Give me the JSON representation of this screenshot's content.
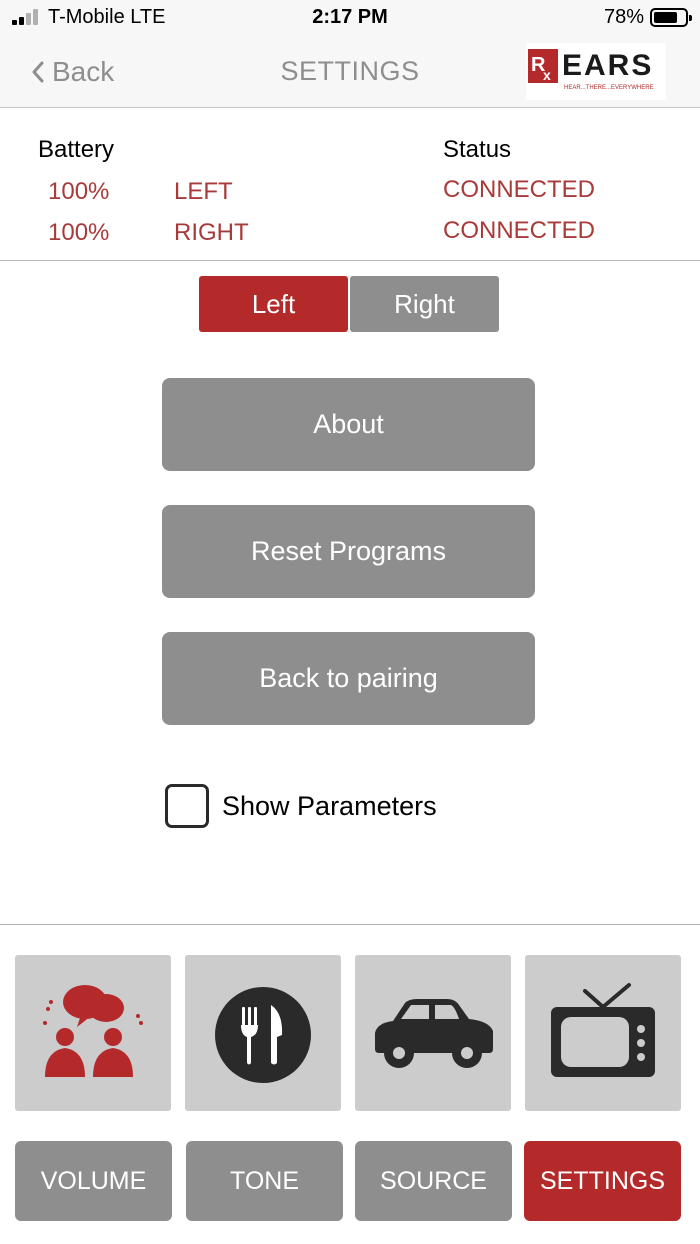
{
  "status_bar": {
    "carrier": "T-Mobile  LTE",
    "time": "2:17 PM",
    "battery_percent": "78%",
    "battery_level": 0.78
  },
  "nav": {
    "back_label": "Back",
    "title": "SETTINGS",
    "logo": {
      "rx": "Rx",
      "wordmark": "EARS",
      "tagline": "HEAR...THERE...EVERYWHERE"
    }
  },
  "info": {
    "battery_header": "Battery",
    "status_header": "Status",
    "rows": [
      {
        "battery": "100%",
        "side": "LEFT",
        "status": "CONNECTED"
      },
      {
        "battery": "100%",
        "side": "RIGHT",
        "status": "CONNECTED"
      }
    ]
  },
  "side_selector": {
    "left_label": "Left",
    "right_label": "Right",
    "selected": "Left"
  },
  "actions": {
    "about": "About",
    "reset_programs": "Reset Programs",
    "back_to_pairing": "Back to pairing"
  },
  "show_parameters": {
    "label": "Show Parameters",
    "checked": false
  },
  "programs": [
    {
      "icon": "conversation-icon",
      "color": "#b42a2a"
    },
    {
      "icon": "restaurant-icon",
      "color": "#2a2a2a"
    },
    {
      "icon": "car-icon",
      "color": "#2a2a2a"
    },
    {
      "icon": "tv-icon",
      "color": "#2a2a2a"
    }
  ],
  "tabs": {
    "volume": "VOLUME",
    "tone": "TONE",
    "source": "SOURCE",
    "settings": "SETTINGS",
    "active": "SETTINGS"
  },
  "colors": {
    "accent_red": "#b42a2a",
    "button_gray": "#8e8e8e",
    "tile_gray": "#cccccc",
    "status_red_text": "#a83a3a"
  }
}
